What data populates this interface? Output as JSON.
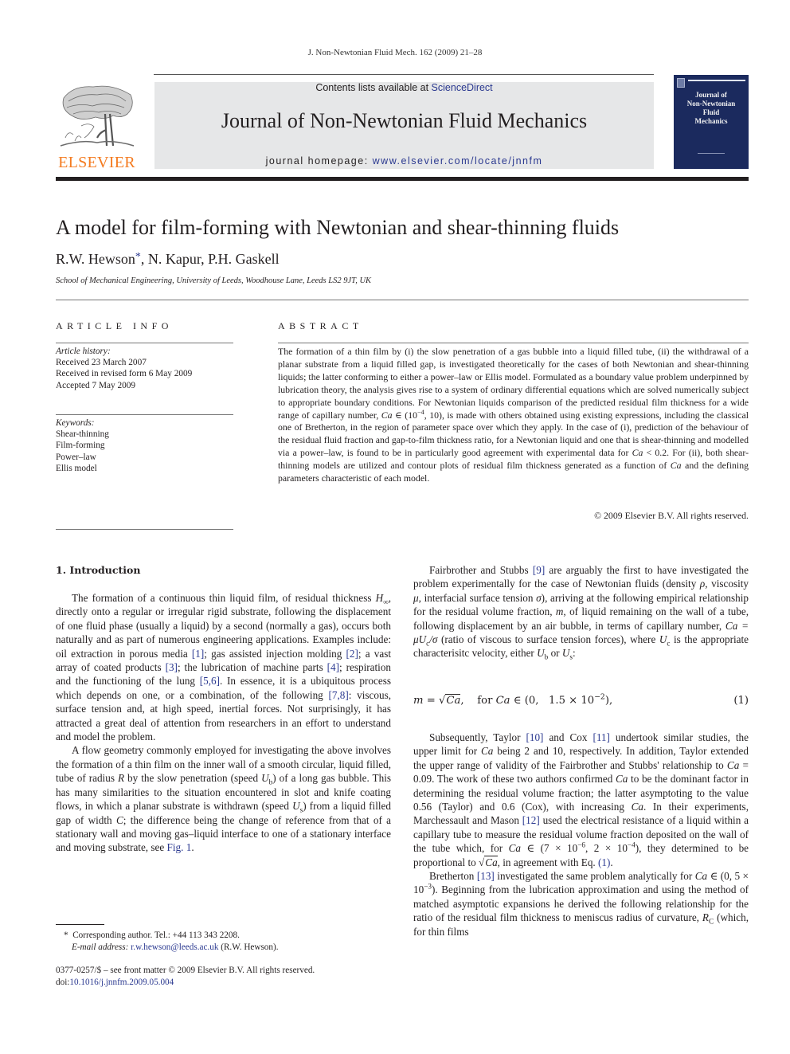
{
  "running_head": "J. Non-Newtonian Fluid Mech. 162 (2009) 21–28",
  "masthead": {
    "publisher_logo_text": "ELSEVIER",
    "contents_prefix": "Contents lists available at ",
    "contents_link": "ScienceDirect",
    "journal_title": "Journal of Non-Newtonian Fluid Mechanics",
    "homepage_prefix": "journal homepage: ",
    "homepage_link": "www.elsevier.com/locate/jnnfm",
    "cover_title_lines": [
      "Journal of",
      "Non-Newtonian",
      "Fluid",
      "Mechanics"
    ]
  },
  "article": {
    "title": "A model for film-forming with Newtonian and shear-thinning fluids",
    "authors": {
      "first": "R.W. Hewson",
      "first_marker": "*",
      "rest": ", N. Kapur, P.H. Gaskell"
    },
    "affiliation": "School of Mechanical Engineering, University of Leeds, Woodhouse Lane, Leeds LS2 9JT, UK"
  },
  "article_info": {
    "heading": "ARTICLE INFO",
    "history_label": "Article history:",
    "history": [
      "Received 23 March 2007",
      "Received in revised form 6 May 2009",
      "Accepted 7 May 2009"
    ],
    "keywords_label": "Keywords:",
    "keywords": [
      "Shear-thinning",
      "Film-forming",
      "Power–law",
      "Ellis model"
    ]
  },
  "abstract": {
    "heading": "ABSTRACT",
    "part1": "The formation of a thin film by (i) the slow penetration of a gas bubble into a liquid filled tube, (ii) the withdrawal of a planar substrate from a liquid filled gap, is investigated theoretically for the cases of both Newtonian and shear-thinning liquids; the latter conforming to either a power–law or Ellis model. Formulated as a boundary value problem underpinned by lubrication theory, the analysis gives rise to a system of ordinary differential equations which are solved numerically subject to appropriate boundary conditions. For Newtonian liquids comparison of the predicted residual film thickness for a wide range of capillary number, ",
    "ca_symbol": "Ca",
    "range1_prefix": " ∈ (10",
    "range1_exp": "−4",
    "range1_suffix": ", 10)",
    "part2": ", is made with others obtained using existing expressions, including the classical one of Bretherton, in the region of parameter space over which they apply. In the case of (i), prediction of the behaviour of the residual fluid fraction and gap-to-film thickness ratio, for a Newtonian liquid and one that is shear-thinning and modelled via a power–law, is found to be in particularly good agreement with experimental data for ",
    "part3": " < 0.2. For (ii), both shear-thinning models are utilized and contour plots of residual film thickness generated as a function of ",
    "part4": " and the defining parameters characteristic of each model.",
    "copyright": "© 2009 Elsevier B.V. All rights reserved."
  },
  "introduction": {
    "heading": "1.  Introduction",
    "p1": {
      "t1": "The formation of a continuous thin liquid film, of residual thickness ",
      "sym_H": "H",
      "sym_H_sub": "∞",
      "t2": ", directly onto a regular or irregular rigid substrate, following the displacement of one fluid phase (usually a liquid) by a second (normally a gas), occurs both naturally and as part of numerous engineering applications. Examples include: oil extraction in porous media ",
      "ref1": "[1]",
      "t3": "; gas assisted injection molding ",
      "ref2": "[2]",
      "t4": "; a vast array of coated products ",
      "ref3": "[3]",
      "t5": "; the lubrication of machine parts ",
      "ref4": "[4]",
      "t6": "; respiration and the functioning of the lung ",
      "ref5": "[5,6]",
      "t7": ". In essence, it is a ubiquitous process which depends on one, or a combination, of the following ",
      "ref6": "[7,8]",
      "t8": ": viscous, surface tension and, at high speed, inertial forces. Not surprisingly, it has attracted a great deal of attention from researchers in an effort to understand and model the problem."
    },
    "p2": {
      "t1": "A flow geometry commonly employed for investigating the above involves the formation of a thin film on the inner wall of a smooth circular, liquid filled, tube of radius ",
      "sym_R": "R",
      "t2": " by the slow penetration (speed ",
      "sym_U": "U",
      "sub_b": "b",
      "t3": ") of a long gas bubble. This has many similarities to the situation encountered in slot and knife coating flows, in which a planar substrate is withdrawn (speed ",
      "sub_s": "s",
      "t4": ") from a liquid filled gap of width ",
      "sym_C": "C",
      "t5": "; the difference being the change of reference from that of a stationary wall and moving gas–liquid interface to one of a stationary interface and moving substrate, see ",
      "fig_ref": "Fig. 1",
      "t6": "."
    },
    "p3": {
      "t1": "Fairbrother and Stubbs ",
      "ref9": "[9]",
      "t2": " are arguably the first to have investigated the problem experimentally for the case of Newtonian fluids (density ",
      "rho": "ρ",
      "t3": ", viscosity ",
      "mu": "μ",
      "t4": ", interfacial surface tension ",
      "sigma": "σ",
      "t5": "), arriving at the following empirical relationship for the residual volume fraction, ",
      "m": "m",
      "t6": ", of liquid remaining on the wall of a tube, following displacement by an air bubble, in terms of capillary number, ",
      "ca_def": "Ca = μU",
      "ca_def_sub": "c",
      "ca_def_tail": "/σ",
      "t7": " (ratio of viscous to surface tension forces), where ",
      "uc": "U",
      "uc_sub": "c",
      "t8": " is the appropriate characterisitc velocity, either ",
      "ub": "U",
      "ub_sub": "b",
      "t9": " or ",
      "us": "U",
      "us_sub": "s",
      "t10": ":"
    },
    "equation1": {
      "lhs": "m",
      "eq": " = √",
      "sqrt_arg": "Ca",
      "cond": ",    for ",
      "ca": "Ca",
      "range": " ∈ (0,   1.5 × 10",
      "exp": "−2",
      "tail": "),",
      "number": "(1)"
    },
    "p4": {
      "t1": "Subsequently, Taylor ",
      "ref10": "[10]",
      "t2": " and Cox ",
      "ref11": "[11]",
      "t3": " undertook similar studies, the upper limit for ",
      "ca": "Ca",
      "t4": " being 2 and 10, respectively. In addition, Taylor extended the upper range of validity of the Fairbrother and Stubbs' relationship to ",
      "t5": " = 0.09. The work of these two authors confirmed ",
      "t6": " to be the dominant factor in determining the residual volume fraction; the latter asymptoting to the value 0.56 (Taylor) and 0.6 (Cox), with increasing ",
      "t7": ". In their experiments, Marchessault and Mason ",
      "ref12": "[12]",
      "t8": " used the electrical resistance of a liquid within a capillary tube to measure the residual volume fraction deposited on the wall of the tube which, for ",
      "t9": " ∈ (7 × 10",
      "e1": "−6",
      "t10": ", 2 × 10",
      "e2": "−4",
      "t11": "), they determined to be proportional to √",
      "t12": ", in agreement with Eq. ",
      "eqref": "(1)",
      "t13": "."
    },
    "p5": {
      "t1": "Bretherton ",
      "ref13": "[13]",
      "t2": " investigated the same problem analytically for ",
      "ca": "Ca",
      "t3": " ∈ (0, 5 × 10",
      "e1": "−3",
      "t4": "). Beginning from the lubrication approximation and using the method of matched asymptotic expansions he derived the following relationship for the ratio of the residual film thickness to meniscus radius of curvature, ",
      "rc": "R",
      "rc_sub": "C",
      "t5": " (which, for thin films"
    }
  },
  "footnotes": {
    "marker": "*",
    "corresponding": "Corresponding author. Tel.: +44 113 343 2208.",
    "email_label": "E-mail address:",
    "email": "r.w.hewson@leeds.ac.uk",
    "email_owner": " (R.W. Hewson).",
    "front_matter": "0377-0257/$ – see front matter © 2009 Elsevier B.V. All rights reserved.",
    "doi_label": "doi:",
    "doi": "10.1016/j.jnnfm.2009.05.004"
  },
  "colors": {
    "link": "#2b3990",
    "elsevier_orange": "#f47b20",
    "masthead_gray": "#e6e7e8",
    "cover_navy": "#1b2a5e"
  }
}
